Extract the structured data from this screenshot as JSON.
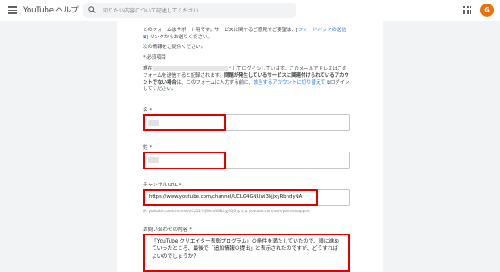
{
  "header": {
    "title": "YouTube ヘルプ",
    "search_placeholder": "知りたい内容について記述してください",
    "avatar_letter": "G"
  },
  "intro": {
    "line1_pre": "このフォームはサポート用です。サービスに関するご意見やご要望は、[",
    "feedback_link": "フィードバックの送信 ⧉",
    "line1_post": "] リンクからお送りください。",
    "line2": "次の情報をご提供ください。",
    "required_note": "* 必須項目"
  },
  "login": {
    "pre": "現在",
    "mid": "としてログインしています。このメールアドレスはこのフォームを送信すると記録されます。",
    "bold": "問題が発生しているサービスに関連付けられているアカウントでない場合",
    "post1": "は、このフォームに入力する前に、",
    "switch_link": "該当するアカウントに切り替えて ⧉",
    "post2": "ログインしてください。"
  },
  "form": {
    "first_name_label": "名 *",
    "last_name_label": "姓 *",
    "channel_url_label": "チャンネルURL *",
    "channel_url_value": "https://www.youtube.com/channel/UCLG4GNUwi3kjjxyRbndyNA",
    "channel_url_hint": "例: youtube.com/channel/UCzD2Y9jWrLnW8LcyJEQG または youtube.com/user/partnersupport",
    "inquiry_label": "お問い合わせの内容 *",
    "inquiry_value": "「YouTube クリエイター表彰プログラム」の条件を満たしていたので、順に進めていったところ、最後で「追加情報の提出」と表示されたのですが、どうすればよいのでしょうか？"
  },
  "colors": {
    "highlight": "#e00000",
    "link": "#1a73e8",
    "avatar": "#e8710a"
  }
}
